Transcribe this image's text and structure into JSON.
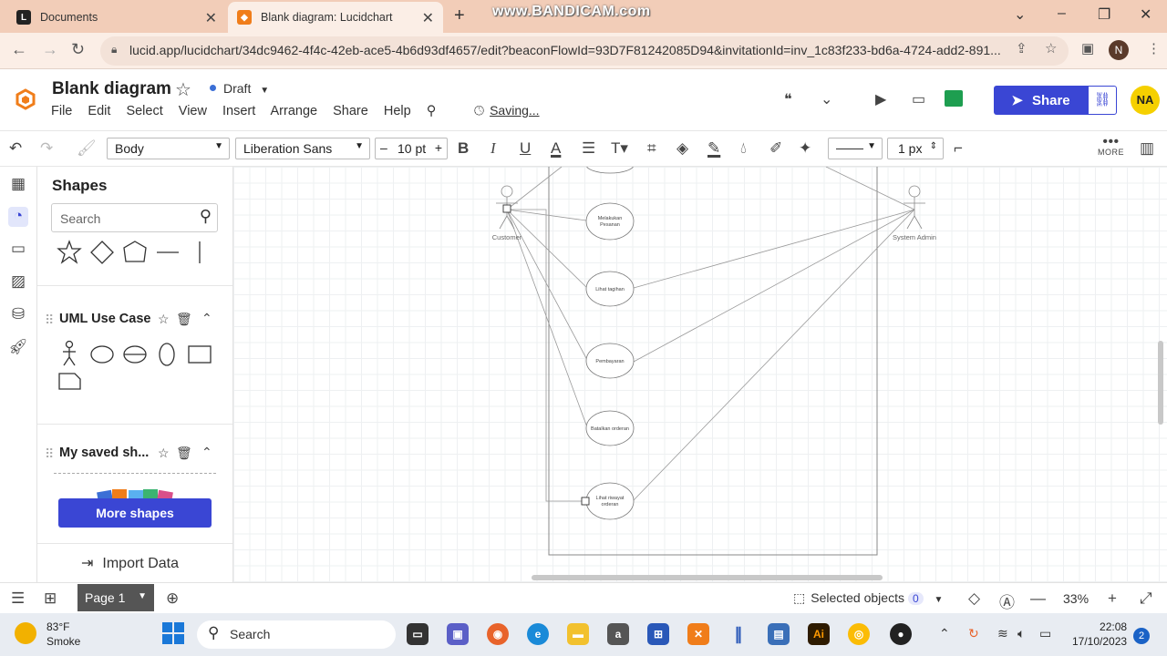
{
  "browser": {
    "tabs": [
      {
        "title": "Documents"
      },
      {
        "title": "Blank diagram: Lucidchart"
      }
    ],
    "watermark": "www.BANDICAM.com",
    "url": "lucid.app/lucidchart/34dc9462-4f4c-42eb-ace5-4b6d93df4657/edit?beaconFlowId=93D7F81242085D94&invitationId=inv_1c83f233-bd6a-4724-add2-891...",
    "profile_initial": "N"
  },
  "app": {
    "title": "Blank diagram",
    "status": "Draft",
    "menu": [
      "File",
      "Edit",
      "Select",
      "View",
      "Insert",
      "Arrange",
      "Share",
      "Help"
    ],
    "saving": "Saving...",
    "share_label": "Share",
    "user_initials": "NA",
    "accent": "#3a46d4"
  },
  "toolbar": {
    "style": "Body",
    "font": "Liberation Sans",
    "font_size": "10 pt",
    "line_width": "1 px",
    "more_label": "MORE"
  },
  "shapes_panel": {
    "title": "Shapes",
    "search_placeholder": "Search",
    "section_uml": "UML Use Case",
    "section_saved": "My saved sh...",
    "more_shapes": "More shapes",
    "import_data": "Import Data"
  },
  "diagram": {
    "actors": [
      "Customer",
      "System Admin"
    ],
    "use_cases": [
      "Melakukan Pesanan",
      "Lihat tagihan",
      "Pembayaran",
      "Batalkan orderan",
      "Lihat riwayat orderan"
    ]
  },
  "bottom": {
    "page_label": "Page 1",
    "selected_label": "Selected objects",
    "selected_count": "0",
    "zoom": "33%"
  },
  "taskbar": {
    "temp": "83°F",
    "weather": "Smoke",
    "search": "Search",
    "time": "22:08",
    "date": "17/10/2023",
    "notifications": "2"
  }
}
